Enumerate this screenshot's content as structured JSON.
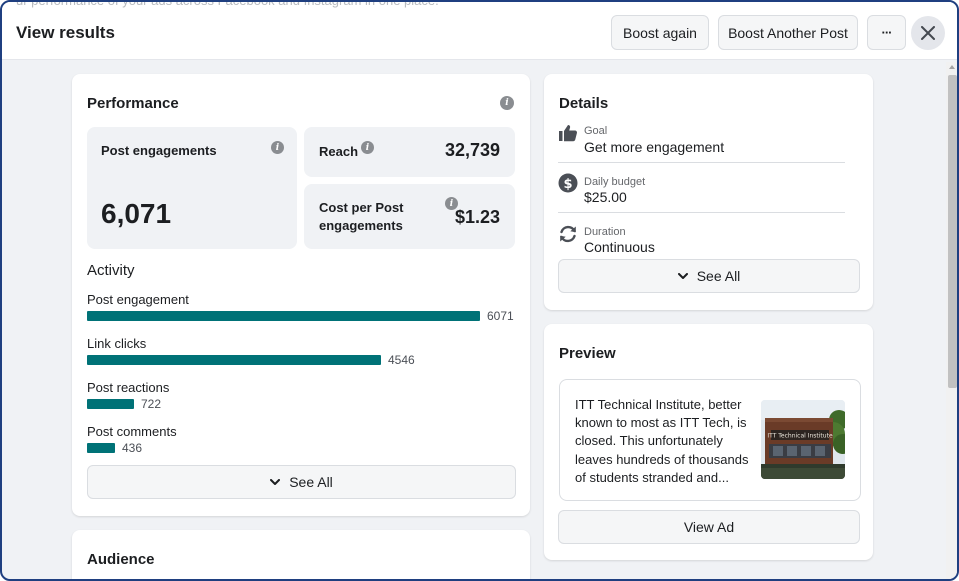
{
  "header": {
    "background_text": "ur performance of your ads across Facebook and Instagram in one place.",
    "title": "View results",
    "boost_again": "Boost again",
    "boost_another": "Boost Another Post",
    "more_label": "···"
  },
  "performance": {
    "title": "Performance",
    "post_engagements_label": "Post engagements",
    "post_engagements_value": "6,071",
    "reach_label": "Reach",
    "reach_value": "32,739",
    "cost_label_line1": "Cost per Post",
    "cost_label_line2": "engagements",
    "cost_value": "$1.23"
  },
  "activity": {
    "title": "Activity",
    "max_value": 6071,
    "items": [
      {
        "label": "Post engagement",
        "value": 6071,
        "display": "6071"
      },
      {
        "label": "Link clicks",
        "value": 4546,
        "display": "4546"
      },
      {
        "label": "Post reactions",
        "value": 722,
        "display": "722"
      },
      {
        "label": "Post comments",
        "value": 436,
        "display": "436"
      }
    ],
    "see_all": "See All"
  },
  "audience": {
    "title": "Audience"
  },
  "details": {
    "title": "Details",
    "goal_label": "Goal",
    "goal_value": "Get more engagement",
    "budget_label": "Daily budget",
    "budget_value": "$25.00",
    "duration_label": "Duration",
    "duration_value": "Continuous",
    "see_all": "See All"
  },
  "preview": {
    "title": "Preview",
    "text": "ITT Technical Institute, better known to most as ITT Tech, is closed. This unfortunately leaves hundreds of thousands of students stranded and...",
    "image_sign_text": "ITT Technical Institute",
    "view_ad": "View Ad"
  },
  "colors": {
    "bar": "#007277",
    "frame_border": "#1f3f80",
    "page_bg": "#f0f2f5"
  }
}
